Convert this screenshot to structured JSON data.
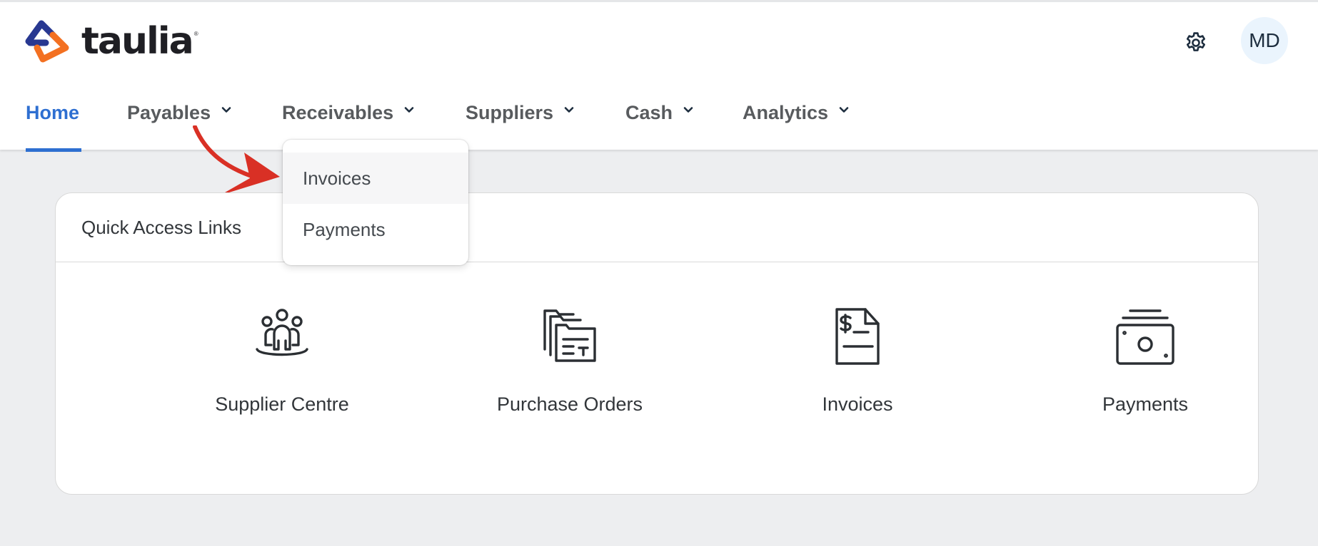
{
  "brand": {
    "name": "taulia",
    "reg": "®"
  },
  "header": {
    "avatar_initials": "MD",
    "settings_icon": "gear-icon"
  },
  "nav": {
    "items": [
      {
        "label": "Home",
        "active": true
      },
      {
        "label": "Payables",
        "has_menu": true
      },
      {
        "label": "Receivables",
        "has_menu": true
      },
      {
        "label": "Suppliers",
        "has_menu": true
      },
      {
        "label": "Cash",
        "has_menu": true
      },
      {
        "label": "Analytics",
        "has_menu": true
      }
    ]
  },
  "dropdown": {
    "items": [
      {
        "label": "Invoices",
        "hovered": true
      },
      {
        "label": "Payments"
      }
    ]
  },
  "quick_access": {
    "title": "Quick Access Links",
    "links": [
      {
        "label": "Supplier Centre",
        "icon": "supplier-group-icon"
      },
      {
        "label": "Purchase Orders",
        "icon": "purchase-orders-icon"
      },
      {
        "label": "Invoices",
        "icon": "invoice-dollar-icon"
      },
      {
        "label": "Payments",
        "icon": "money-stack-icon"
      }
    ]
  },
  "colors": {
    "accent": "#2e6fd1",
    "logo_navy": "#283891",
    "logo_orange": "#f37021",
    "annotation_arrow": "#d93025",
    "page_bg": "#edeef0"
  }
}
